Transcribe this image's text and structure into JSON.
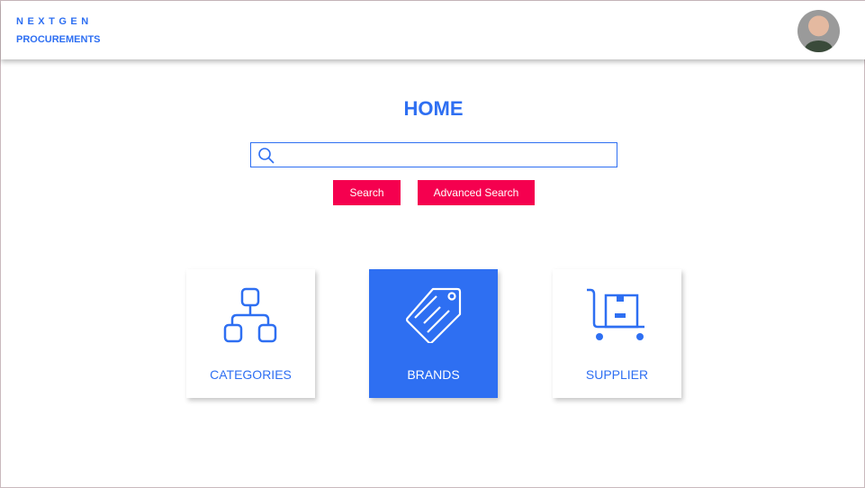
{
  "header": {
    "logo_line1": "NEXTGEN",
    "logo_line2": "PROCUREMENTS",
    "avatar": "user-avatar"
  },
  "main": {
    "title": "HOME",
    "search": {
      "placeholder": "",
      "value": "",
      "icon": "search-icon"
    },
    "buttons": {
      "search": "Search",
      "advanced": "Advanced Search"
    },
    "cards": [
      {
        "label": "CATEGORIES",
        "icon": "hierarchy-icon"
      },
      {
        "label": "BRANDS",
        "icon": "tag-icon",
        "active": true
      },
      {
        "label": "SUPPLIER",
        "icon": "trolley-box-icon"
      }
    ]
  },
  "colors": {
    "accent": "#2e6ff2",
    "button": "#f5004f"
  }
}
